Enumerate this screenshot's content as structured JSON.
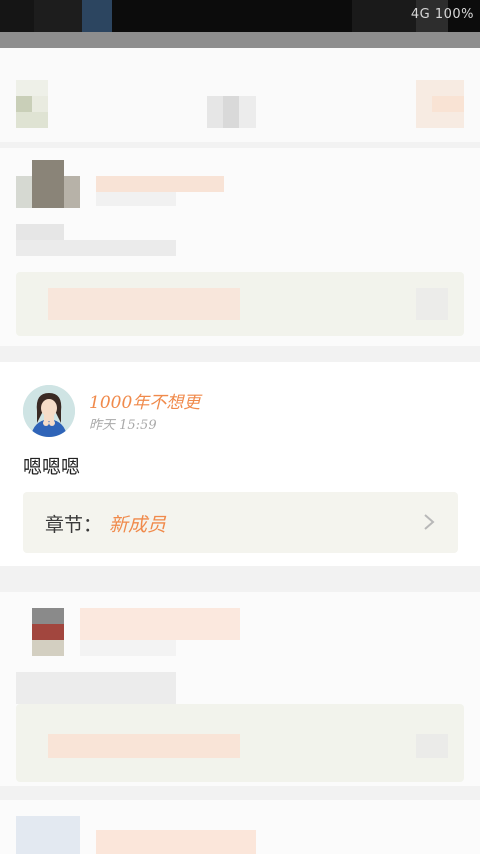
{
  "status_bar": {
    "text": "4G 100%"
  },
  "post": {
    "username": "1000年不想更",
    "timestamp": "昨天 15:59",
    "content": "嗯嗯嗯",
    "chapter_label": "章节：",
    "chapter_name": "新成员"
  },
  "colors": {
    "accent": "#f08a4b",
    "card_background": "#ffffff",
    "chapter_box": "#f4f4ee",
    "status_bar": "#0c0c0c"
  },
  "icons": {
    "chapter_arrow": "chevron-right-icon"
  }
}
